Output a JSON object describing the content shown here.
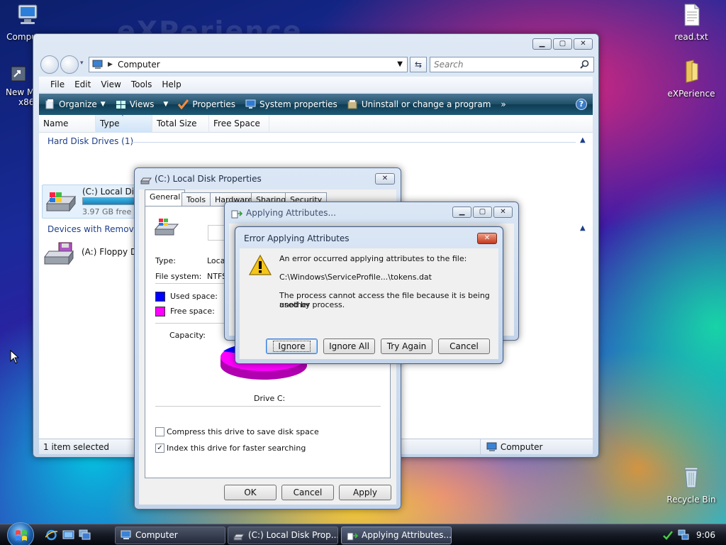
{
  "desktop": {
    "watermark": "eXPerience",
    "icons": {
      "computer": "Computer",
      "newm_line1": "New M",
      "newm_line2": "x86",
      "readtxt": "read.txt",
      "experience": "eXPerience",
      "recycle": "Recycle Bin"
    }
  },
  "explorer": {
    "address": "Computer",
    "search_placeholder": "Search",
    "menu": [
      "File",
      "Edit",
      "View",
      "Tools",
      "Help"
    ],
    "toolbar": {
      "organize": "Organize",
      "views": "Views",
      "properties": "Properties",
      "system_properties": "System properties",
      "uninstall": "Uninstall or change a program"
    },
    "columns": [
      "Name",
      "Type",
      "Total Size",
      "Free Space"
    ],
    "groups": {
      "hdd": "Hard Disk Drives (1)",
      "removable": "Devices with Removabl"
    },
    "drives": {
      "c_label": "(C:) Local Disk",
      "c_free": "3.97 GB free of",
      "c_used_fraction": 0.55,
      "a_label": "(A:) Floppy Dis"
    },
    "status_left": "1 item selected",
    "status_right": "Computer"
  },
  "properties": {
    "title": "(C:) Local Disk Properties",
    "tabs": [
      "General",
      "Tools",
      "Hardware",
      "Sharing",
      "Security"
    ],
    "type_label": "Type:",
    "type_value": "Local",
    "fs_label": "File system:",
    "fs_value": "NTFS",
    "used_label": "Used space:",
    "free_label": "Free space:",
    "capacity_label": "Capacity:",
    "drive_label": "Drive C:",
    "compress_label": "Compress this drive to save disk space",
    "index_label": "Index this drive for faster searching",
    "ok": "OK",
    "cancel": "Cancel",
    "apply": "Apply",
    "colors": {
      "used": "#0000ff",
      "free": "#ff00ff"
    }
  },
  "applying": {
    "title": "Applying Attributes..."
  },
  "error": {
    "title": "Error Applying Attributes",
    "line1": "An error occurred applying attributes to the file:",
    "path": "C:\\Windows\\ServiceProfile...\\tokens.dat",
    "line2a": "The process cannot access the file because it is being used by",
    "line2b": "another process.",
    "btn_ignore": "Ignore",
    "btn_ignore_all": "Ignore All",
    "btn_try_again": "Try Again",
    "btn_cancel": "Cancel"
  },
  "taskbar": {
    "tasks": [
      "Computer",
      "(C:) Local Disk Prop...",
      "Applying Attributes..."
    ],
    "clock": "9:06"
  }
}
